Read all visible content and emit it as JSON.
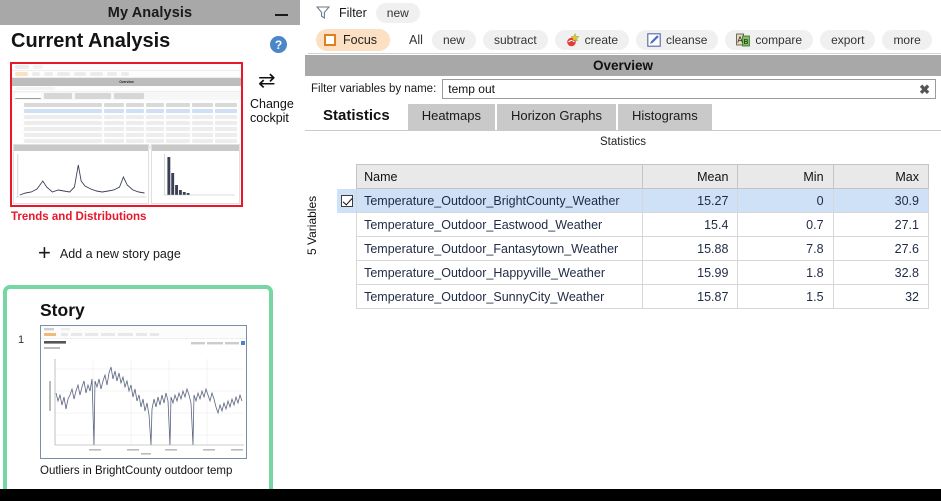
{
  "window": {
    "title": "My Analysis",
    "minimize_label": "minimize"
  },
  "left_panel": {
    "current_analysis_heading": "Current Analysis",
    "help_icon": "help-icon",
    "help_glyph": "?",
    "thumbnail_caption": "Trends and Distributions",
    "thumbnail_overview_label": "Overview",
    "change_cockpit": {
      "icon": "swap-arrows-icon",
      "glyph": "⇄",
      "label_line1": "Change",
      "label_line2": "cockpit"
    },
    "add_story_page": {
      "icon": "plus-icon",
      "glyph": "+",
      "label": "Add a new story page"
    },
    "story": {
      "heading": "Story",
      "page_number": "1",
      "caption": "Outliers in BrightCounty outdoor temp",
      "border_color": "#76d6a4"
    },
    "thumb_border_color": "#e8172b",
    "caption_color": "#e8172b"
  },
  "toolbar": {
    "filter": {
      "icon": "funnel-icon",
      "label": "Filter",
      "chip": "new"
    },
    "focus": {
      "icon": "square-outline-icon",
      "label": "Focus",
      "background": "#fbe0c4",
      "accent": "#e07f21"
    },
    "all_label": "All",
    "actions": [
      {
        "label": "new",
        "icon": ""
      },
      {
        "label": "subtract",
        "icon": ""
      },
      {
        "label": "create",
        "icon": "create-icon"
      },
      {
        "label": "cleanse",
        "icon": "cleanse-pencil-icon"
      },
      {
        "label": "compare",
        "icon": "compare-ab-icon"
      },
      {
        "label": "export",
        "icon": ""
      },
      {
        "label": "more",
        "icon": ""
      }
    ]
  },
  "overview": {
    "title": "Overview",
    "filter_label": "Filter variables by name:",
    "filter_value": "temp out",
    "filter_placeholder": "",
    "clear_icon": "clear-x-icon",
    "clear_glyph": "✖",
    "tabs": [
      {
        "label": "Statistics",
        "active": true
      },
      {
        "label": "Heatmaps",
        "active": false
      },
      {
        "label": "Horizon Graphs",
        "active": false
      },
      {
        "label": "Histograms",
        "active": false
      }
    ],
    "subtitle": "Statistics",
    "variables_count_label": "5 Variables"
  },
  "table": {
    "columns": [
      "Name",
      "Mean",
      "Min",
      "Max"
    ],
    "rows": [
      {
        "checked": true,
        "selected": true,
        "name": "Temperature_Outdoor_BrightCounty_Weather",
        "mean": "15.27",
        "min": "0",
        "max": "30.9"
      },
      {
        "checked": false,
        "selected": false,
        "name": "Temperature_Outdoor_Eastwood_Weather",
        "mean": "15.4",
        "min": "0.7",
        "max": "27.1"
      },
      {
        "checked": false,
        "selected": false,
        "name": "Temperature_Outdoor_Fantasytown_Weather",
        "mean": "15.88",
        "min": "7.8",
        "max": "27.6"
      },
      {
        "checked": false,
        "selected": false,
        "name": "Temperature_Outdoor_Happyville_Weather",
        "mean": "15.99",
        "min": "1.8",
        "max": "32.8"
      },
      {
        "checked": false,
        "selected": false,
        "name": "Temperature_Outdoor_SunnyCity_Weather",
        "mean": "15.87",
        "min": "1.5",
        "max": "32"
      }
    ]
  }
}
